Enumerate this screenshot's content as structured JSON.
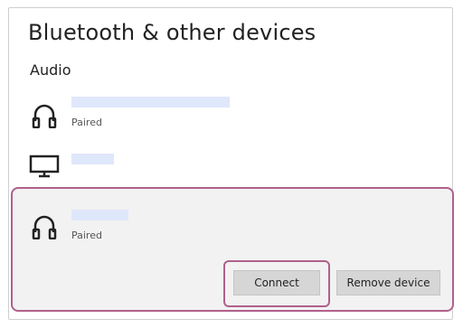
{
  "header": {
    "title": "Bluetooth & other devices"
  },
  "sections": {
    "audio_label": "Audio"
  },
  "devices": [
    {
      "icon": "headphones-icon",
      "status": "Paired"
    },
    {
      "icon": "monitor-icon",
      "status": ""
    },
    {
      "icon": "headphones-icon",
      "status": "Paired"
    }
  ],
  "actions": {
    "connect_label": "Connect",
    "remove_label": "Remove device"
  },
  "colors": {
    "highlight": "#b0608c",
    "name_placeholder": "#dfe7fb",
    "panel": "#f2f2f2"
  }
}
